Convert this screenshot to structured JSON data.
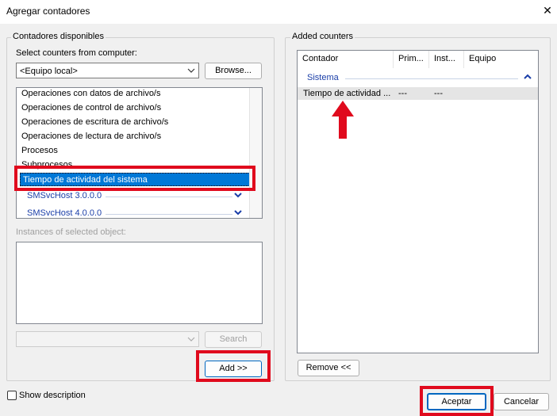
{
  "window": {
    "title": "Agregar contadores",
    "close_glyph": "✕"
  },
  "available": {
    "legend": "Contadores disponibles",
    "select_label": "Select counters from computer:",
    "computer_value": "<Equipo local>",
    "browse_label": "Browse...",
    "items": [
      "Operaciones con datos de archivo/s",
      "Operaciones de control de archivo/s",
      "Operaciones de escritura de archivo/s",
      "Operaciones de lectura de archivo/s",
      "Procesos",
      "Subprocesos"
    ],
    "selected_item": "Tiempo de actividad del sistema",
    "groups": [
      "SMSvcHost 3.0.0.0",
      "SMSvcHost 4.0.0.0"
    ],
    "instances_label": "Instances of selected object:",
    "search_label": "Search",
    "add_label": "Add >>"
  },
  "added": {
    "legend": "Added counters",
    "columns": [
      "Contador",
      "Prim...",
      "Inst...",
      "Equipo"
    ],
    "group_name": "Sistema",
    "row": {
      "counter": "Tiempo de actividad ...",
      "parent": "---",
      "instance": "---"
    },
    "remove_label": "Remove <<"
  },
  "footer": {
    "show_description": "Show description",
    "accept": "Aceptar",
    "cancel": "Cancelar"
  },
  "colors": {
    "highlight": "#e00a1d",
    "selection": "#0078d7",
    "group_text": "#1a3ea8"
  }
}
